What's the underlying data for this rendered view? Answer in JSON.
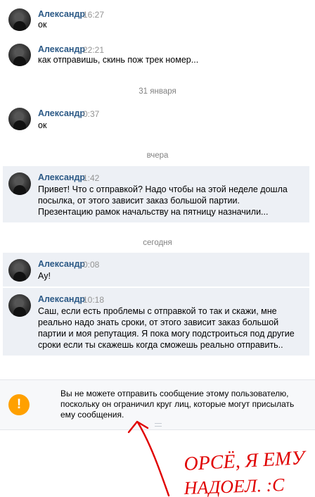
{
  "messages": [
    {
      "author": "Александр",
      "time": "16:27",
      "text": "ок"
    },
    {
      "author": "Александр",
      "time": "22:21",
      "text": "как отправишь, скинь пож трек номер..."
    },
    {
      "author": "Александр",
      "time": "0:37",
      "text": "ок"
    },
    {
      "author": "Александр",
      "time": "1:42",
      "lines": [
        "Привет! Что с отправкой? Надо чтобы на этой неделе дошла",
        "посылка, от этого зависит заказ большой партии.",
        "Презентацию рамок начальству на пятницу назначили..."
      ]
    },
    {
      "author": "Александр",
      "time": "0:08",
      "text": "Ау!"
    },
    {
      "author": "Александр",
      "time": "10:18",
      "lines": [
        "Саш, если есть проблемы с отправкой то так и скажи, мне",
        "реально надо знать сроки, от этого зависит заказ большой",
        "партии и моя репутация. Я пока могу подстроиться под другие",
        "сроки если ты скажешь когда сможешь реально отправить.."
      ]
    }
  ],
  "separators": {
    "jan31": "31 января",
    "yesterday": "вчера",
    "today": "сегодня"
  },
  "notice": {
    "icon": "exclamation-icon",
    "icon_glyph": "!",
    "lines": [
      "Вы не можете отправить сообщение этому пользователю,",
      "поскольку он ограничил круг лиц, которые могут присылать",
      "ему сообщения."
    ]
  },
  "annotation": {
    "line1": "ОРСЁ, Я ЕМУ",
    "line2": "НАДОЕЛ. :С",
    "color": "#e00000"
  },
  "colors": {
    "author": "#2a5885",
    "time": "#939393",
    "unread_bg": "#edf0f5",
    "warning": "#ffa000"
  }
}
